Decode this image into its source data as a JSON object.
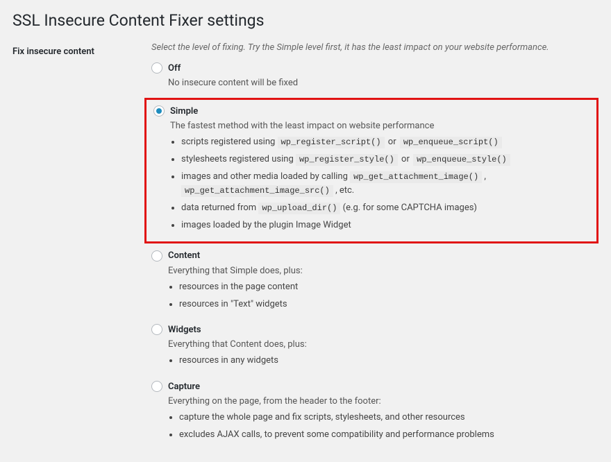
{
  "page_title": "SSL Insecure Content Fixer settings",
  "section_label": "Fix insecure content",
  "section_description": "Select the level of fixing. Try the Simple level first, it has the least impact on your website performance.",
  "options": {
    "off": {
      "label": "Off",
      "desc": "No insecure content will be fixed"
    },
    "simple": {
      "label": "Simple",
      "desc": "The fastest method with the least impact on website performance",
      "bullets": {
        "b1": {
          "pre": "scripts registered using ",
          "code1": "wp_register_script()",
          "or": " or ",
          "code2": "wp_enqueue_script()"
        },
        "b2": {
          "pre": "stylesheets registered using ",
          "code1": "wp_register_style()",
          "or": " or ",
          "code2": "wp_enqueue_style()"
        },
        "b3": {
          "pre": "images and other media loaded by calling ",
          "code1": "wp_get_attachment_image()",
          "comma": " , ",
          "code2": "wp_get_attachment_image_src()",
          "post": " , etc."
        },
        "b4": {
          "pre": "data returned from ",
          "code1": "wp_upload_dir()",
          "post": " (e.g. for some CAPTCHA images)"
        },
        "b5": {
          "text": "images loaded by the plugin Image Widget"
        }
      }
    },
    "content": {
      "label": "Content",
      "desc": "Everything that Simple does, plus:",
      "bullets": {
        "b1": "resources in the page content",
        "b2": "resources in \"Text\" widgets"
      }
    },
    "widgets": {
      "label": "Widgets",
      "desc": "Everything that Content does, plus:",
      "bullets": {
        "b1": "resources in any widgets"
      }
    },
    "capture": {
      "label": "Capture",
      "desc": "Everything on the page, from the header to the footer:",
      "bullets": {
        "b1": "capture the whole page and fix scripts, stylesheets, and other resources",
        "b2": "excludes AJAX calls, to prevent some compatibility and performance problems"
      }
    }
  }
}
